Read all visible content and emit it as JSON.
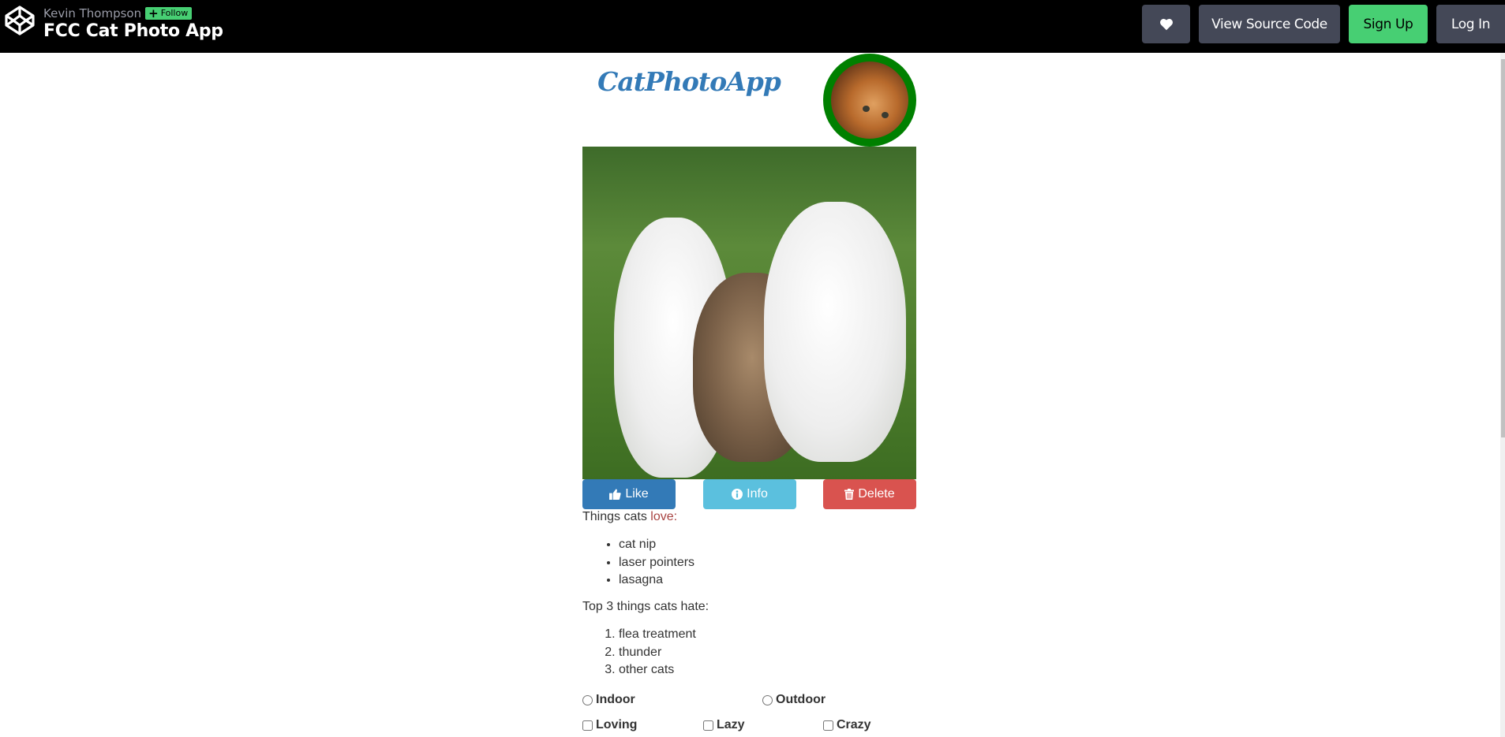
{
  "header": {
    "author": "Kevin Thompson",
    "follow_label": "Follow",
    "pen_title": "FCC Cat Photo App",
    "buttons": {
      "heart_icon": "heart-icon",
      "view_source": "View Source Code",
      "sign_up": "Sign Up",
      "log_in": "Log In"
    }
  },
  "app": {
    "title": "CatPhotoApp",
    "avatar_alt": "kitten avatar",
    "main_image_alt": "three kittens running towards the camera",
    "buttons": {
      "like": "Like",
      "info": "Info",
      "delete": "Delete"
    },
    "love_prefix": "Things cats ",
    "love_word": "love:",
    "loves": [
      "cat nip",
      "laser pointers",
      "lasagna"
    ],
    "hate_heading": "Top 3 things cats hate:",
    "hates": [
      "flea treatment",
      "thunder",
      "other cats"
    ],
    "radios": [
      "Indoor",
      "Outdoor"
    ],
    "checkboxes": [
      "Loving",
      "Lazy",
      "Crazy"
    ]
  },
  "colors": {
    "primary": "#337ab7",
    "info": "#5bc0de",
    "danger": "#d9534f",
    "avatar_border": "#008000",
    "codepen_green": "#47cf73",
    "codepen_button": "#444857"
  }
}
